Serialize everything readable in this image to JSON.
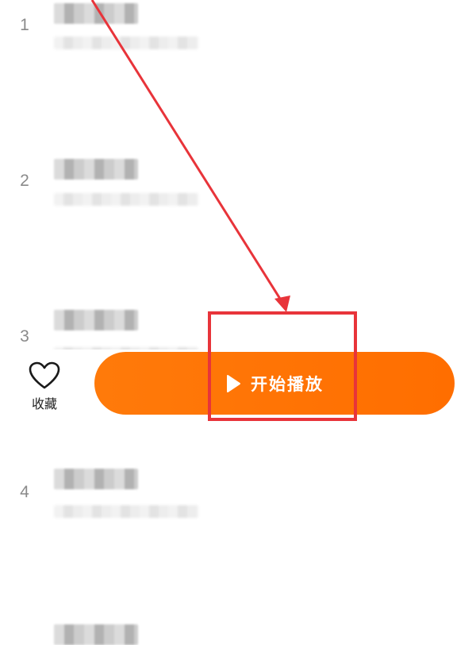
{
  "tracks": [
    {
      "number": "1"
    },
    {
      "number": "2"
    },
    {
      "number": "3"
    },
    {
      "number": "4"
    },
    {
      "number": ""
    }
  ],
  "bottom_bar": {
    "favorite_label": "收藏",
    "play_label": "开始播放"
  },
  "colors": {
    "accent": "#ff7200",
    "annotation": "#e8343a"
  },
  "icons": {
    "favorite": "heart-icon",
    "play": "play-icon"
  }
}
